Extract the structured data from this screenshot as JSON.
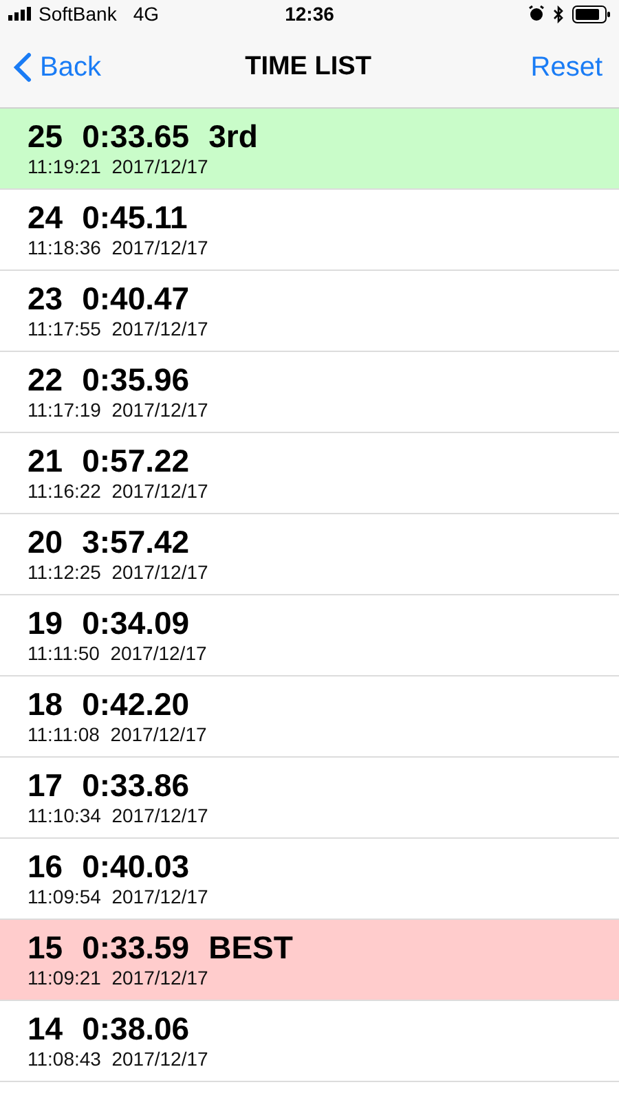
{
  "status_bar": {
    "carrier": "SoftBank",
    "network": "4G",
    "time": "12:36"
  },
  "nav_bar": {
    "back": "Back",
    "title": "TIME LIST",
    "action": "Reset"
  },
  "rows": [
    {
      "number": "25",
      "time": "0:33.65",
      "tag": "3rd",
      "kind": "third",
      "timestamp": "11:19:21  2017/12/17"
    },
    {
      "number": "24",
      "time": "0:45.11",
      "kind": "normal",
      "timestamp": "11:18:36  2017/12/17"
    },
    {
      "number": "23",
      "time": "0:40.47",
      "kind": "normal",
      "timestamp": "11:17:55  2017/12/17"
    },
    {
      "number": "22",
      "time": "0:35.96",
      "kind": "normal",
      "timestamp": "11:17:19  2017/12/17"
    },
    {
      "number": "21",
      "time": "0:57.22",
      "kind": "normal",
      "timestamp": "11:16:22  2017/12/17"
    },
    {
      "number": "20",
      "time": "3:57.42",
      "kind": "normal",
      "timestamp": "11:12:25  2017/12/17"
    },
    {
      "number": "19",
      "time": "0:34.09",
      "kind": "normal",
      "timestamp": "11:11:50  2017/12/17"
    },
    {
      "number": "18",
      "time": "0:42.20",
      "kind": "normal",
      "timestamp": "11:11:08  2017/12/17"
    },
    {
      "number": "17",
      "time": "0:33.86",
      "kind": "normal",
      "timestamp": "11:10:34  2017/12/17"
    },
    {
      "number": "16",
      "time": "0:40.03",
      "kind": "normal",
      "timestamp": "11:09:54  2017/12/17"
    },
    {
      "number": "15",
      "time": "0:33.59",
      "tag": "BEST",
      "kind": "best",
      "timestamp": "11:09:21  2017/12/17"
    },
    {
      "number": "14",
      "time": "0:38.06",
      "kind": "normal",
      "timestamp": "11:08:43  2017/12/17"
    }
  ]
}
